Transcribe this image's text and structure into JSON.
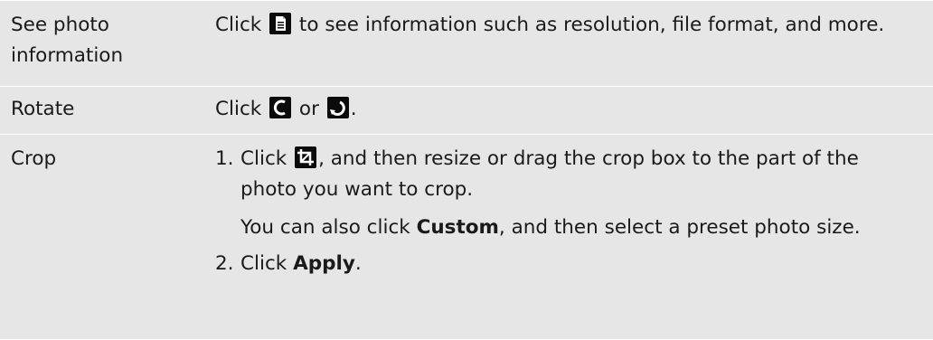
{
  "rows": [
    {
      "label": "See photo information",
      "desc_before": "Click",
      "icon": "photo-info-icon",
      "desc_after": "to see information such as resolution, file format, and more."
    },
    {
      "label": "Rotate",
      "desc_before": "Click",
      "icon_left": "rotate-left-icon",
      "middle": "or",
      "icon_right": "rotate-right-icon",
      "end": "."
    },
    {
      "label": "Crop",
      "steps": [
        {
          "num": "1.",
          "before": "Click",
          "icon": "crop-icon",
          "after": ", and then resize or drag the crop box to the part of the photo you want to crop."
        },
        {
          "num": "2.",
          "before": "Click",
          "bold": "Apply",
          "after": "."
        }
      ],
      "note_before": "You can also click",
      "note_bold": "Custom",
      "note_after": ", and then select a preset photo size."
    }
  ]
}
